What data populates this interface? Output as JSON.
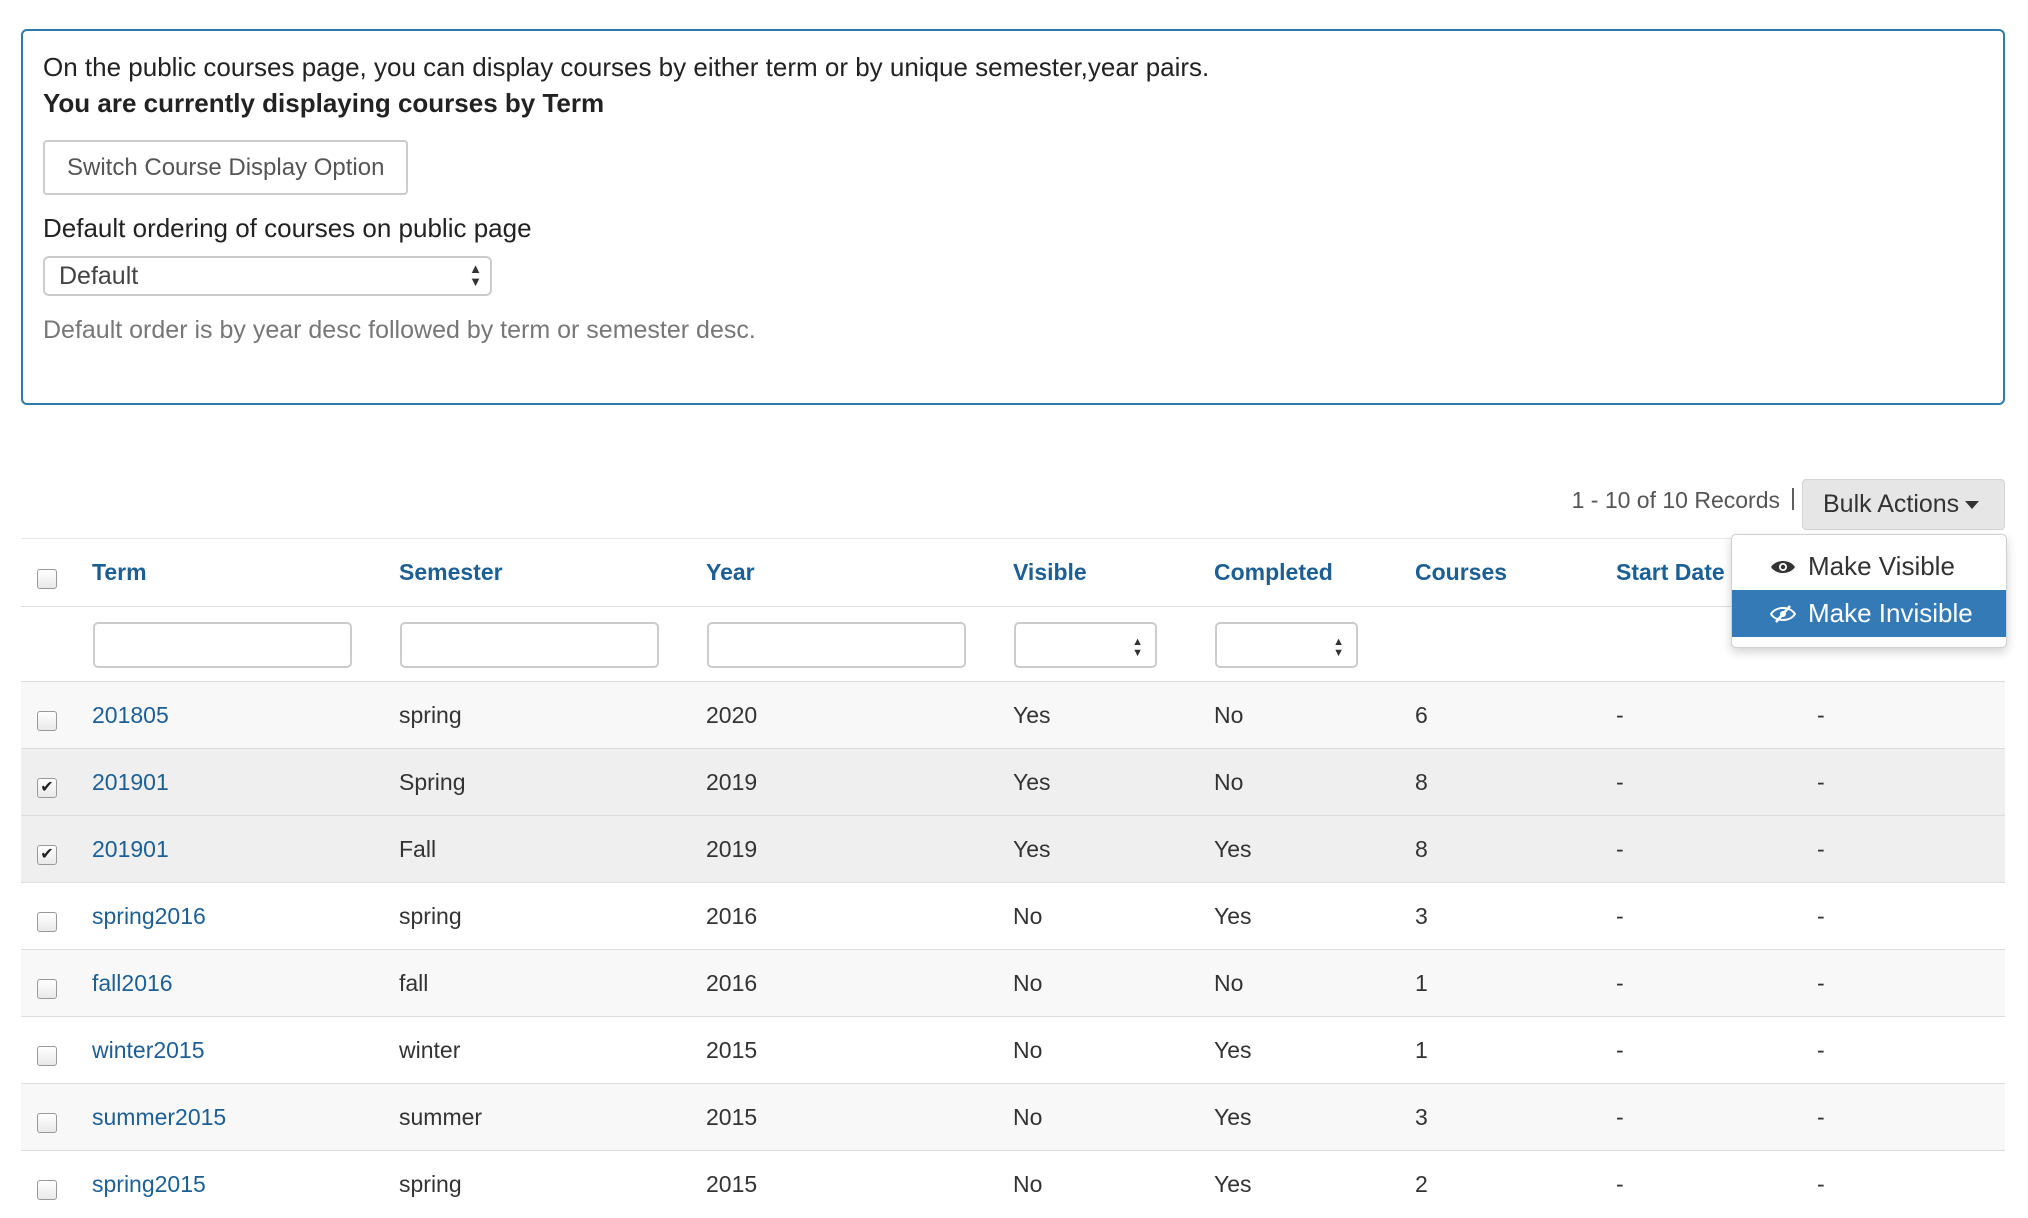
{
  "info": {
    "line1": "On the public courses page, you can display courses by either term or by unique semester,year pairs.",
    "line2": "You are currently displaying courses by Term",
    "switch_label": "Switch Course Display Option",
    "order_label": "Default ordering of courses on public page",
    "order_value": "Default",
    "help_text": "Default order is by year desc followed by term or semester desc."
  },
  "toolbar": {
    "records": "1 - 10 of 10 Records",
    "separator": "|",
    "bulk_label": "Bulk Actions"
  },
  "bulk_menu": {
    "items": [
      {
        "label": "Make Visible",
        "icon": "eye-icon"
      },
      {
        "label": "Make Invisible",
        "icon": "eye-slash-icon"
      }
    ]
  },
  "table": {
    "headers": [
      "Term",
      "Semester",
      "Year",
      "Visible",
      "Completed",
      "Courses",
      "Start Date"
    ],
    "rows": [
      {
        "term": "201805",
        "semester": "spring",
        "year": "2020",
        "visible": "Yes",
        "completed": "No",
        "courses": "6",
        "start": "-",
        "end": "-",
        "checked": false
      },
      {
        "term": "201901",
        "semester": "Spring",
        "year": "2019",
        "visible": "Yes",
        "completed": "No",
        "courses": "8",
        "start": "-",
        "end": "-",
        "checked": true
      },
      {
        "term": "201901",
        "semester": "Fall",
        "year": "2019",
        "visible": "Yes",
        "completed": "Yes",
        "courses": "8",
        "start": "-",
        "end": "-",
        "checked": true
      },
      {
        "term": "spring2016",
        "semester": "spring",
        "year": "2016",
        "visible": "No",
        "completed": "Yes",
        "courses": "3",
        "start": "-",
        "end": "-",
        "checked": false
      },
      {
        "term": "fall2016",
        "semester": "fall",
        "year": "2016",
        "visible": "No",
        "completed": "No",
        "courses": "1",
        "start": "-",
        "end": "-",
        "checked": false
      },
      {
        "term": "winter2015",
        "semester": "winter",
        "year": "2015",
        "visible": "No",
        "completed": "Yes",
        "courses": "1",
        "start": "-",
        "end": "-",
        "checked": false
      },
      {
        "term": "summer2015",
        "semester": "summer",
        "year": "2015",
        "visible": "No",
        "completed": "Yes",
        "courses": "3",
        "start": "-",
        "end": "-",
        "checked": false
      },
      {
        "term": "spring2015",
        "semester": "spring",
        "year": "2015",
        "visible": "No",
        "completed": "Yes",
        "courses": "2",
        "start": "-",
        "end": "-",
        "checked": false
      }
    ]
  },
  "colors": {
    "accent": "#337ab7",
    "link": "#1c5f95",
    "panel_border": "#2f7aa6"
  }
}
